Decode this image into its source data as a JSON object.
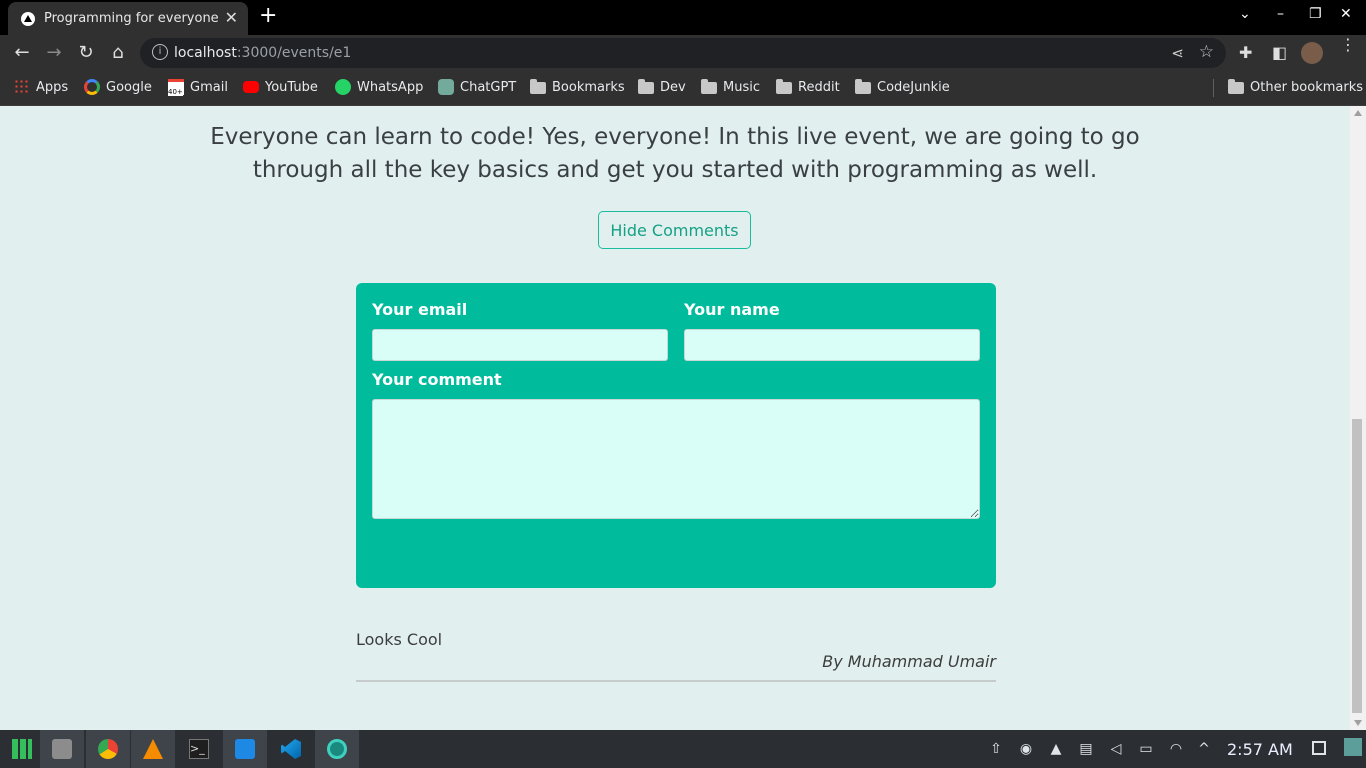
{
  "browser": {
    "tab_title": "Programming for everyone",
    "url_host": "localhost",
    "url_path": ":3000/events/e1",
    "new_tab": "+",
    "close_tab": "✕"
  },
  "bookmarks": [
    {
      "label": "Apps",
      "icon": "apps-grid-icon"
    },
    {
      "label": "Google",
      "icon": "google-icon"
    },
    {
      "label": "Gmail",
      "icon": "gmail-icon"
    },
    {
      "label": "YouTube",
      "icon": "youtube-icon"
    },
    {
      "label": "WhatsApp",
      "icon": "whatsapp-icon"
    },
    {
      "label": "ChatGPT",
      "icon": "chatgpt-icon"
    },
    {
      "label": "Bookmarks",
      "icon": "folder-icon"
    },
    {
      "label": "Dev",
      "icon": "folder-icon"
    },
    {
      "label": "Music",
      "icon": "folder-icon"
    },
    {
      "label": "Reddit",
      "icon": "folder-icon"
    },
    {
      "label": "CodeJunkie",
      "icon": "folder-icon"
    }
  ],
  "other_bookmarks": "Other bookmarks",
  "gmail_badge": "40+",
  "event": {
    "description": "Everyone can learn to code! Yes, everyone! In this live event, we are going to go through all the key basics and get you started with programming as well."
  },
  "comments_toggle": "Hide Comments",
  "form": {
    "email_label": "Your email",
    "name_label": "Your name",
    "comment_label": "Your comment",
    "email_value": "",
    "name_value": "",
    "comment_value": ""
  },
  "comments": [
    {
      "text": "Looks Cool",
      "author": "By Muhammad Umair"
    }
  ],
  "taskbar": {
    "clock": "2:57 AM",
    "apps": [
      "manjaro-menu-icon",
      "file-manager-icon",
      "chrome-icon",
      "vlc-icon",
      "terminal-icon",
      "store-icon",
      "vscode-icon",
      "steam-icon"
    ]
  },
  "colors": {
    "accent": "#1abc9c",
    "form_bg": "#01bc9c",
    "page_bg": "#e1f0ef",
    "input_bg": "#d9fdf7"
  }
}
